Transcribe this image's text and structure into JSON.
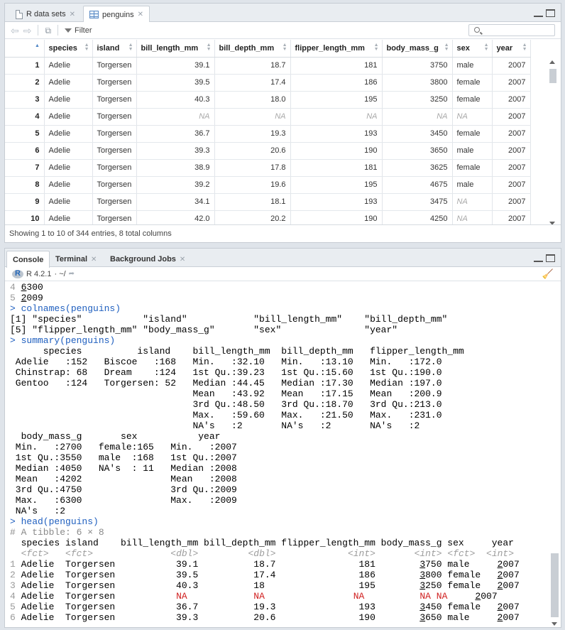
{
  "source_tabs": [
    {
      "label": "R data sets",
      "active": false
    },
    {
      "label": "penguins",
      "active": true
    }
  ],
  "viewer": {
    "filter_label": "Filter",
    "search_placeholder": "",
    "columns": [
      "",
      "species",
      "island",
      "bill_length_mm",
      "bill_depth_mm",
      "flipper_length_mm",
      "body_mass_g",
      "sex",
      "year"
    ],
    "rows": [
      [
        "1",
        "Adelie",
        "Torgersen",
        "39.1",
        "18.7",
        "181",
        "3750",
        "male",
        "2007"
      ],
      [
        "2",
        "Adelie",
        "Torgersen",
        "39.5",
        "17.4",
        "186",
        "3800",
        "female",
        "2007"
      ],
      [
        "3",
        "Adelie",
        "Torgersen",
        "40.3",
        "18.0",
        "195",
        "3250",
        "female",
        "2007"
      ],
      [
        "4",
        "Adelie",
        "Torgersen",
        "NA",
        "NA",
        "NA",
        "NA",
        "NA",
        "2007"
      ],
      [
        "5",
        "Adelie",
        "Torgersen",
        "36.7",
        "19.3",
        "193",
        "3450",
        "female",
        "2007"
      ],
      [
        "6",
        "Adelie",
        "Torgersen",
        "39.3",
        "20.6",
        "190",
        "3650",
        "male",
        "2007"
      ],
      [
        "7",
        "Adelie",
        "Torgersen",
        "38.9",
        "17.8",
        "181",
        "3625",
        "female",
        "2007"
      ],
      [
        "8",
        "Adelie",
        "Torgersen",
        "39.2",
        "19.6",
        "195",
        "4675",
        "male",
        "2007"
      ],
      [
        "9",
        "Adelie",
        "Torgersen",
        "34.1",
        "18.1",
        "193",
        "3475",
        "NA",
        "2007"
      ],
      [
        "10",
        "Adelie",
        "Torgersen",
        "42.0",
        "20.2",
        "190",
        "4250",
        "NA",
        "2007"
      ]
    ],
    "status": "Showing 1 to 10 of 344 entries, 8 total columns"
  },
  "console_tabs": [
    {
      "label": "Console",
      "active": true,
      "closable": false
    },
    {
      "label": "Terminal",
      "active": false,
      "closable": true
    },
    {
      "label": "Background Jobs",
      "active": false,
      "closable": true
    }
  ],
  "console": {
    "r_version": "R 4.2.1",
    "working_dir": "· ~/",
    "lines": [
      [
        {
          "t": "4 ",
          "c": "ln"
        },
        {
          "t": "6",
          "c": "u"
        },
        {
          "t": "300"
        }
      ],
      [
        {
          "t": "5 ",
          "c": "ln"
        },
        {
          "t": "2",
          "c": "u"
        },
        {
          "t": "009"
        }
      ],
      [
        {
          "t": "> colnames(penguins)",
          "c": "cmd"
        }
      ],
      [
        {
          "t": "[1] \"species\"           \"island\"            \"bill_length_mm\"    \"bill_depth_mm\""
        }
      ],
      [
        {
          "t": "[5] \"flipper_length_mm\" \"body_mass_g\"       \"sex\"               \"year\""
        }
      ],
      [
        {
          "t": "> summary(penguins)",
          "c": "cmd"
        }
      ],
      [
        {
          "t": "      species          island    bill_length_mm  bill_depth_mm   flipper_length_mm"
        }
      ],
      [
        {
          "t": " Adelie   :152   Biscoe   :168   Min.   :32.10   Min.   :13.10   Min.   :172.0"
        }
      ],
      [
        {
          "t": " Chinstrap: 68   Dream    :124   1st Qu.:39.23   1st Qu.:15.60   1st Qu.:190.0"
        }
      ],
      [
        {
          "t": " Gentoo   :124   Torgersen: 52   Median :44.45   Median :17.30   Median :197.0"
        }
      ],
      [
        {
          "t": "                                 Mean   :43.92   Mean   :17.15   Mean   :200.9"
        }
      ],
      [
        {
          "t": "                                 3rd Qu.:48.50   3rd Qu.:18.70   3rd Qu.:213.0"
        }
      ],
      [
        {
          "t": "                                 Max.   :59.60   Max.   :21.50   Max.   :231.0"
        }
      ],
      [
        {
          "t": "                                 NA's   :2       NA's   :2       NA's   :2"
        }
      ],
      [
        {
          "t": "  body_mass_g       sex           year"
        }
      ],
      [
        {
          "t": " Min.   :2700   female:165   Min.   :2007"
        }
      ],
      [
        {
          "t": " 1st Qu.:3550   male  :168   1st Qu.:2007"
        }
      ],
      [
        {
          "t": " Median :4050   NA's  : 11   Median :2008"
        }
      ],
      [
        {
          "t": " Mean   :4202                Mean   :2008"
        }
      ],
      [
        {
          "t": " 3rd Qu.:4750                3rd Qu.:2009"
        }
      ],
      [
        {
          "t": " Max.   :6300                Max.   :2009"
        }
      ],
      [
        {
          "t": " NA's   :2"
        }
      ],
      [
        {
          "t": "> head(penguins)",
          "c": "cmd"
        }
      ],
      [
        {
          "t": "# A tibble: 6 × 8",
          "c": "cmt"
        }
      ],
      [
        {
          "t": "  species island    bill_length_mm bill_depth_mm flipper_length_mm body_mass_g sex     year"
        }
      ],
      [
        {
          "t": "  "
        },
        {
          "t": "<fct>",
          "c": "typ"
        },
        {
          "t": "   "
        },
        {
          "t": "<fct>",
          "c": "typ"
        },
        {
          "t": "              "
        },
        {
          "t": "<dbl>",
          "c": "typ"
        },
        {
          "t": "         "
        },
        {
          "t": "<dbl>",
          "c": "typ"
        },
        {
          "t": "             "
        },
        {
          "t": "<int>",
          "c": "typ"
        },
        {
          "t": "       "
        },
        {
          "t": "<int>",
          "c": "typ"
        },
        {
          "t": " "
        },
        {
          "t": "<fct>",
          "c": "typ"
        },
        {
          "t": "  "
        },
        {
          "t": "<int>",
          "c": "typ"
        }
      ],
      [
        {
          "t": "1",
          "c": "rowi"
        },
        {
          "t": " Adelie  Torgersen           39.1          18.7               181        "
        },
        {
          "t": "3",
          "c": "u"
        },
        {
          "t": "750 male     "
        },
        {
          "t": "2",
          "c": "u"
        },
        {
          "t": "007"
        }
      ],
      [
        {
          "t": "2",
          "c": "rowi"
        },
        {
          "t": " Adelie  Torgersen           39.5          17.4               186        "
        },
        {
          "t": "3",
          "c": "u"
        },
        {
          "t": "800 female   "
        },
        {
          "t": "2",
          "c": "u"
        },
        {
          "t": "007"
        }
      ],
      [
        {
          "t": "3",
          "c": "rowi"
        },
        {
          "t": " Adelie  Torgersen           40.3          18                 195        "
        },
        {
          "t": "3",
          "c": "u"
        },
        {
          "t": "250 female   "
        },
        {
          "t": "2",
          "c": "u"
        },
        {
          "t": "007"
        }
      ],
      [
        {
          "t": "4",
          "c": "rowi"
        },
        {
          "t": " Adelie  Torgersen           "
        },
        {
          "t": "NA",
          "c": "nar"
        },
        {
          "t": "            "
        },
        {
          "t": "NA",
          "c": "nar"
        },
        {
          "t": "                "
        },
        {
          "t": "NA",
          "c": "nar"
        },
        {
          "t": "          "
        },
        {
          "t": "NA",
          "c": "nar"
        },
        {
          "t": " "
        },
        {
          "t": "NA",
          "c": "nar"
        },
        {
          "t": "     "
        },
        {
          "t": "2",
          "c": "u"
        },
        {
          "t": "007"
        }
      ],
      [
        {
          "t": "5",
          "c": "rowi"
        },
        {
          "t": " Adelie  Torgersen           36.7          19.3               193        "
        },
        {
          "t": "3",
          "c": "u"
        },
        {
          "t": "450 female   "
        },
        {
          "t": "2",
          "c": "u"
        },
        {
          "t": "007"
        }
      ],
      [
        {
          "t": "6",
          "c": "rowi"
        },
        {
          "t": " Adelie  Torgersen           39.3          20.6               190        "
        },
        {
          "t": "3",
          "c": "u"
        },
        {
          "t": "650 male     "
        },
        {
          "t": "2",
          "c": "u"
        },
        {
          "t": "007"
        }
      ]
    ]
  },
  "colors": {
    "prompt_blue": "#1f5fbf",
    "na_red": "#d02020",
    "na_grey": "#a8a8a8"
  }
}
